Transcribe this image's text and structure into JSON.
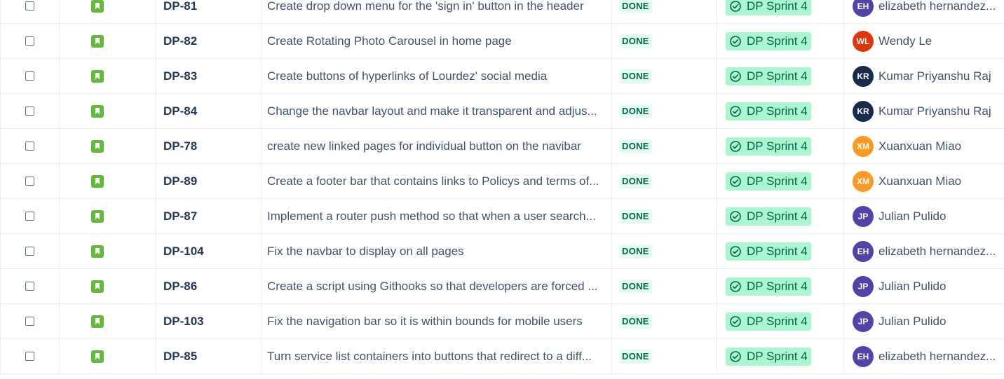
{
  "rows": [
    {
      "key": "DP-81",
      "summary": "Create drop down menu for the 'sign in' button in the header",
      "status": "DONE",
      "sprint": "DP Sprint 4",
      "assignee": {
        "initials": "EH",
        "name": "elizabeth hernandez...",
        "color": "#5243aa"
      }
    },
    {
      "key": "DP-82",
      "summary": "Create Rotating Photo Carousel in home page",
      "status": "DONE",
      "sprint": "DP Sprint 4",
      "assignee": {
        "initials": "WL",
        "name": "Wendy Le",
        "color": "#de350b"
      }
    },
    {
      "key": "DP-83",
      "summary": "Create buttons of hyperlinks of Lourdez' social media",
      "status": "DONE",
      "sprint": "DP Sprint 4",
      "assignee": {
        "initials": "KR",
        "name": "Kumar Priyanshu Raj",
        "color": "#172b4d"
      }
    },
    {
      "key": "DP-84",
      "summary": "Change the navbar layout and make it transparent and adjus...",
      "status": "DONE",
      "sprint": "DP Sprint 4",
      "assignee": {
        "initials": "KR",
        "name": "Kumar Priyanshu Raj",
        "color": "#172b4d"
      }
    },
    {
      "key": "DP-78",
      "summary": "create new linked pages for individual button on the navibar",
      "status": "DONE",
      "sprint": "DP Sprint 4",
      "assignee": {
        "initials": "XM",
        "name": "Xuanxuan Miao",
        "color": "#ff991f"
      }
    },
    {
      "key": "DP-89",
      "summary": "Create a footer bar that contains links to Policys and terms of...",
      "status": "DONE",
      "sprint": "DP Sprint 4",
      "assignee": {
        "initials": "XM",
        "name": "Xuanxuan Miao",
        "color": "#ff991f"
      }
    },
    {
      "key": "DP-87",
      "summary": "Implement a router push method so that when a user search...",
      "status": "DONE",
      "sprint": "DP Sprint 4",
      "assignee": {
        "initials": "JP",
        "name": "Julian Pulido",
        "color": "#5243aa"
      }
    },
    {
      "key": "DP-104",
      "summary": "Fix the navbar to display on all pages",
      "status": "DONE",
      "sprint": "DP Sprint 4",
      "assignee": {
        "initials": "EH",
        "name": "elizabeth hernandez...",
        "color": "#5243aa"
      }
    },
    {
      "key": "DP-86",
      "summary": "Create a script using Githooks so that developers are forced ...",
      "status": "DONE",
      "sprint": "DP Sprint 4",
      "assignee": {
        "initials": "JP",
        "name": "Julian Pulido",
        "color": "#5243aa"
      }
    },
    {
      "key": "DP-103",
      "summary": "Fix the navigation bar so it is within bounds for mobile users",
      "status": "DONE",
      "sprint": "DP Sprint 4",
      "assignee": {
        "initials": "JP",
        "name": "Julian Pulido",
        "color": "#5243aa"
      }
    },
    {
      "key": "DP-85",
      "summary": "Turn service list containers into buttons that redirect to a diff...",
      "status": "DONE",
      "sprint": "DP Sprint 4",
      "assignee": {
        "initials": "EH",
        "name": "elizabeth hernandez...",
        "color": "#5243aa"
      }
    }
  ],
  "icons": {
    "issue_type": "story-icon",
    "sprint": "check-circle-icon"
  },
  "colors": {
    "done_bg": "#e3fcef",
    "done_text": "#006644",
    "sprint_bg": "#abf5d1",
    "story_green": "#63ba3c"
  }
}
